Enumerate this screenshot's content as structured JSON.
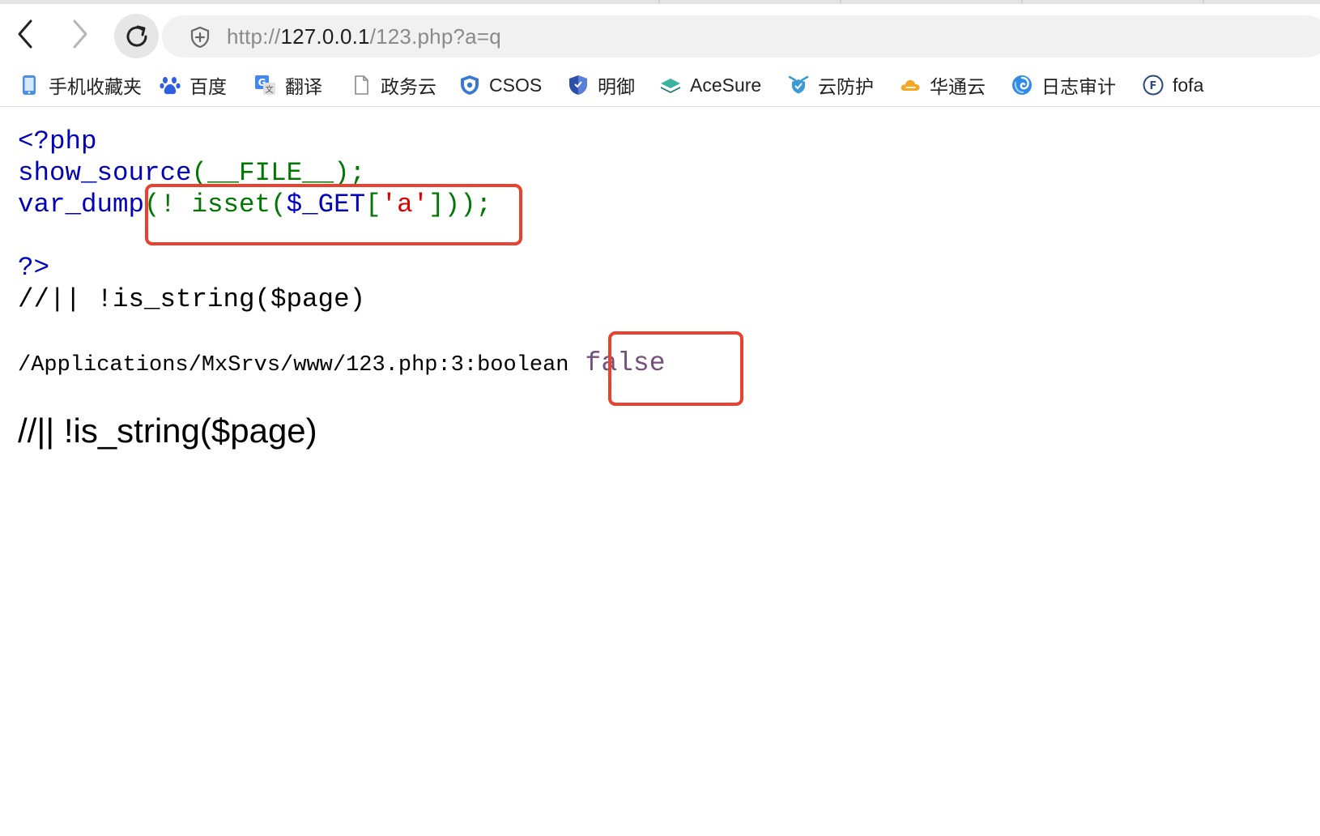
{
  "browser": {
    "url": {
      "scheme": "http://",
      "host": "127.0.0.1",
      "path": "/123.php?a=q"
    }
  },
  "bookmarks": [
    {
      "label": "手机收藏夹",
      "icon": "phone-icon"
    },
    {
      "label": "百度",
      "icon": "baidu-paw-icon"
    },
    {
      "label": "翻译",
      "icon": "translate-icon"
    },
    {
      "label": "政务云",
      "icon": "document-icon"
    },
    {
      "label": "CSOS",
      "icon": "csos-shield-icon"
    },
    {
      "label": "明御",
      "icon": "shield-icon"
    },
    {
      "label": "AceSure",
      "icon": "layers-icon"
    },
    {
      "label": "云防护",
      "icon": "cloud-guard-icon"
    },
    {
      "label": "华通云",
      "icon": "cloud-icon"
    },
    {
      "label": "日志审计",
      "icon": "swirl-icon"
    },
    {
      "label": "fofa",
      "icon": "fofa-icon"
    }
  ],
  "source": {
    "line1": "<?php",
    "line2_fn": "show_source",
    "line2_rest": "(__FILE__);",
    "line3_fn": "var_dump",
    "line3_open": "(! ",
    "line3_isset": "isset",
    "line3_paren": "(",
    "line3_var": "$_GET",
    "line3_bracket": "[",
    "line3_key": "'a'",
    "line3_close": "]));",
    "line5": "?>",
    "line6": "//|| !is_string($page)"
  },
  "output": {
    "dump_prefix": "/Applications/MxSrvs/www/123.php:3:boolean",
    "dump_value": "false",
    "trailing_text": "//|| !is_string($page)"
  },
  "colors": {
    "highlight_box": "#e8412f",
    "php_keyword": "#0000bb",
    "php_default": "#007700",
    "php_string": "#dd0000",
    "xdebug_value": "#75507b"
  }
}
